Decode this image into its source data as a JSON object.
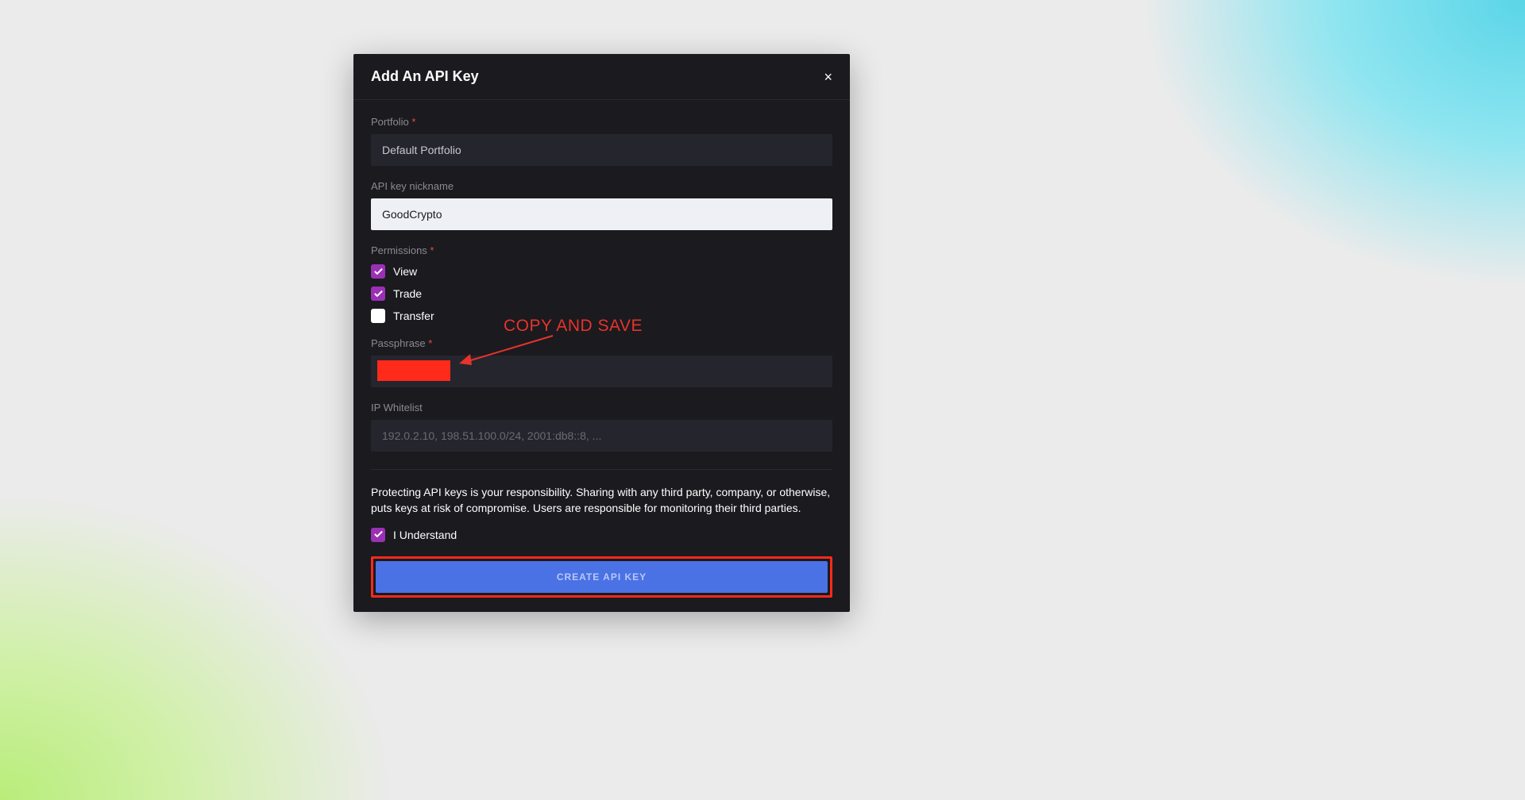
{
  "modal": {
    "title": "Add An API Key",
    "close": "×"
  },
  "form": {
    "portfolio": {
      "label": "Portfolio",
      "value": "Default Portfolio"
    },
    "nickname": {
      "label": "API key nickname",
      "value": "GoodCrypto"
    },
    "permissions": {
      "label": "Permissions",
      "options": [
        {
          "label": "View",
          "checked": true
        },
        {
          "label": "Trade",
          "checked": true
        },
        {
          "label": "Transfer",
          "checked": false
        }
      ]
    },
    "passphrase": {
      "label": "Passphrase",
      "value": ""
    },
    "ip_whitelist": {
      "label": "IP Whitelist",
      "placeholder": "192.0.2.10, 198.51.100.0/24, 2001:db8::8, ..."
    },
    "disclaimer": "Protecting API keys is your responsibility. Sharing with any third party, company, or otherwise, puts keys at risk of compromise. Users are responsible for monitoring their third parties.",
    "understand": {
      "label": "I Understand",
      "checked": true
    },
    "submit": "CREATE API KEY"
  },
  "annotation": "COPY AND SAVE"
}
